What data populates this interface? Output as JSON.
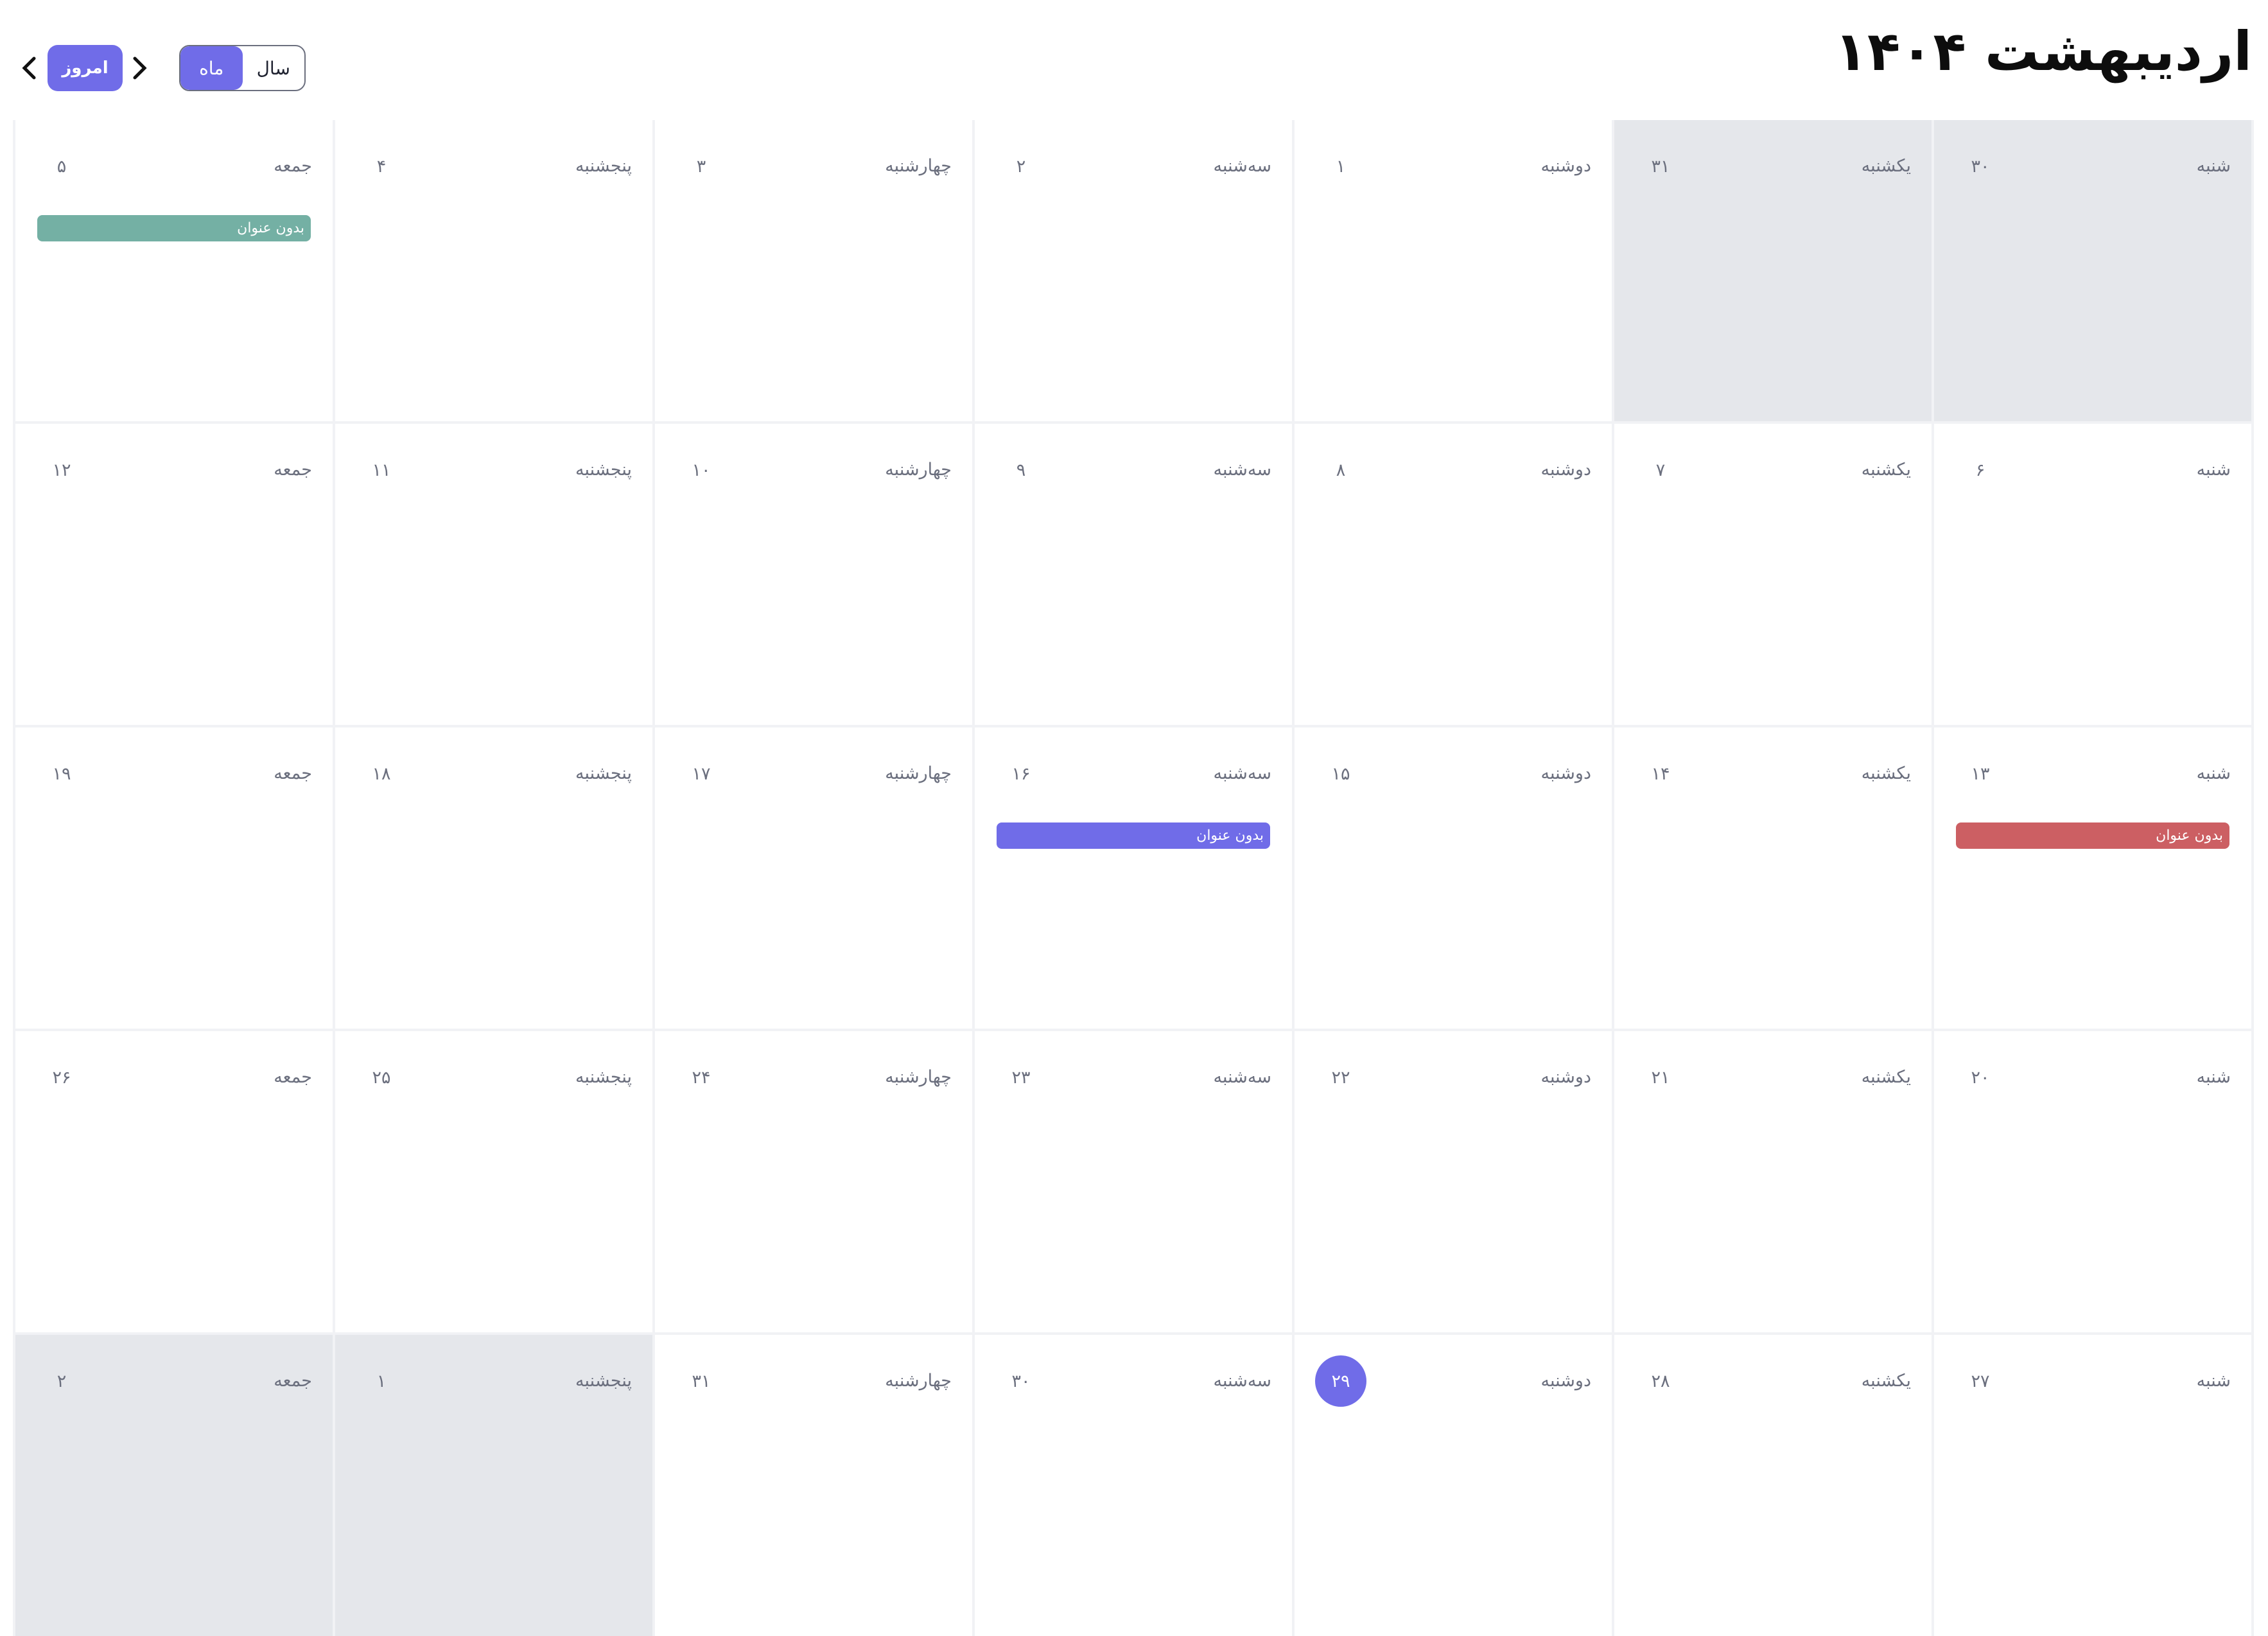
{
  "header": {
    "title": "اردیبهشت ۱۴۰۴",
    "today_label": "امروز",
    "view_toggle": {
      "month_label": "ماه",
      "year_label": "سال",
      "active": "month"
    },
    "prev_icon": "chevron-left-icon",
    "next_icon": "chevron-right-icon"
  },
  "colors": {
    "accent": "#706ce8",
    "muted_cell": "#e5e7eb",
    "event_teal": "#74b0a4",
    "event_red": "#cc5f63",
    "event_purple": "#706ce8"
  },
  "weekdays": [
    "شنبه",
    "یکشنبه",
    "دوشنبه",
    "سه‌شنبه",
    "چهارشنبه",
    "پنجشنبه",
    "جمعه"
  ],
  "weeks": [
    [
      {
        "day": "۳۰",
        "muted": true
      },
      {
        "day": "۳۱",
        "muted": true
      },
      {
        "day": "۱"
      },
      {
        "day": "۲"
      },
      {
        "day": "۳"
      },
      {
        "day": "۴"
      },
      {
        "day": "۵",
        "event": {
          "title": "بدون عنوان",
          "color": "#74b0a4"
        }
      }
    ],
    [
      {
        "day": "۶"
      },
      {
        "day": "۷"
      },
      {
        "day": "۸"
      },
      {
        "day": "۹"
      },
      {
        "day": "۱۰"
      },
      {
        "day": "۱۱"
      },
      {
        "day": "۱۲"
      }
    ],
    [
      {
        "day": "۱۳",
        "event": {
          "title": "بدون عنوان",
          "color": "#cc5f63"
        }
      },
      {
        "day": "۱۴"
      },
      {
        "day": "۱۵"
      },
      {
        "day": "۱۶",
        "event": {
          "title": "بدون عنوان",
          "color": "#706ce8"
        }
      },
      {
        "day": "۱۷"
      },
      {
        "day": "۱۸"
      },
      {
        "day": "۱۹"
      }
    ],
    [
      {
        "day": "۲۰"
      },
      {
        "day": "۲۱"
      },
      {
        "day": "۲۲"
      },
      {
        "day": "۲۳"
      },
      {
        "day": "۲۴"
      },
      {
        "day": "۲۵"
      },
      {
        "day": "۲۶"
      }
    ],
    [
      {
        "day": "۲۷"
      },
      {
        "day": "۲۸"
      },
      {
        "day": "۲۹",
        "today": true
      },
      {
        "day": "۳۰"
      },
      {
        "day": "۳۱"
      },
      {
        "day": "۱",
        "muted": true
      },
      {
        "day": "۲",
        "muted": true
      }
    ]
  ]
}
